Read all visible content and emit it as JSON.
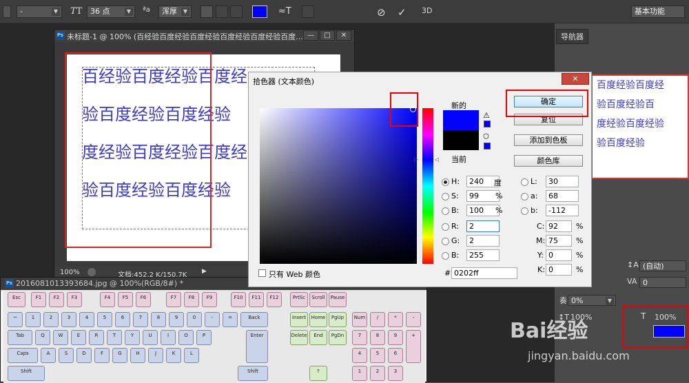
{
  "options_bar": {
    "font_size": "36 点",
    "aa_label": "a",
    "aa_mode": "浑厚",
    "workspace": "基本功能",
    "threed": "3D",
    "font_style": "-"
  },
  "panels": {
    "navigator_tab": "导航器"
  },
  "navigator_preview": [
    "百度经验百度经",
    "验百度经验百",
    "度经验百度经验",
    "验百度经验"
  ],
  "document": {
    "title": "未标题-1 @ 100% (百经验百度经验百度经验百度经验百度经验百度...",
    "lines": [
      "百经验百度经验百度经",
      "验百度经验百度经验",
      "度经验百度经验百度经",
      "验百度经验百度经验"
    ],
    "zoom": "100%",
    "doc_info": "文档:452.2 K/150.7K"
  },
  "dialog": {
    "title": "拾色器 (文本颜色)",
    "new_label": "新的",
    "current_label": "当前",
    "new_color": "#0202ff",
    "current_color": "#000000",
    "buttons": {
      "ok": "确定",
      "reset": "复位",
      "add_swatch": "添加到色板",
      "libraries": "颜色库"
    },
    "fields": {
      "H": {
        "value": "240",
        "unit": "度"
      },
      "S": {
        "value": "99",
        "unit": "%"
      },
      "B": {
        "value": "100",
        "unit": "%"
      },
      "R": {
        "value": "2"
      },
      "G": {
        "value": "2"
      },
      "B2": {
        "value": "255"
      },
      "L": {
        "value": "30"
      },
      "a": {
        "value": "68"
      },
      "b": {
        "value": "-112"
      },
      "C": {
        "value": "92",
        "unit": "%"
      },
      "M": {
        "value": "75",
        "unit": "%"
      },
      "Y": {
        "value": "0",
        "unit": "%"
      },
      "K": {
        "value": "0",
        "unit": "%"
      },
      "hex": "0202ff"
    },
    "web_only": "只有 Web 颜色"
  },
  "char_panel": {
    "tracking": "0%",
    "leading_auto": "(自动)",
    "scale_v": "100%",
    "scale_h": "100%",
    "kerning": "0",
    "color": "#0000ff"
  },
  "keyboard_window": {
    "title": "2016081013393684.jpg @ 100%(RGB/8#) *"
  },
  "watermark": {
    "main": "Bai经验",
    "url": "jingyan.baidu.com"
  }
}
